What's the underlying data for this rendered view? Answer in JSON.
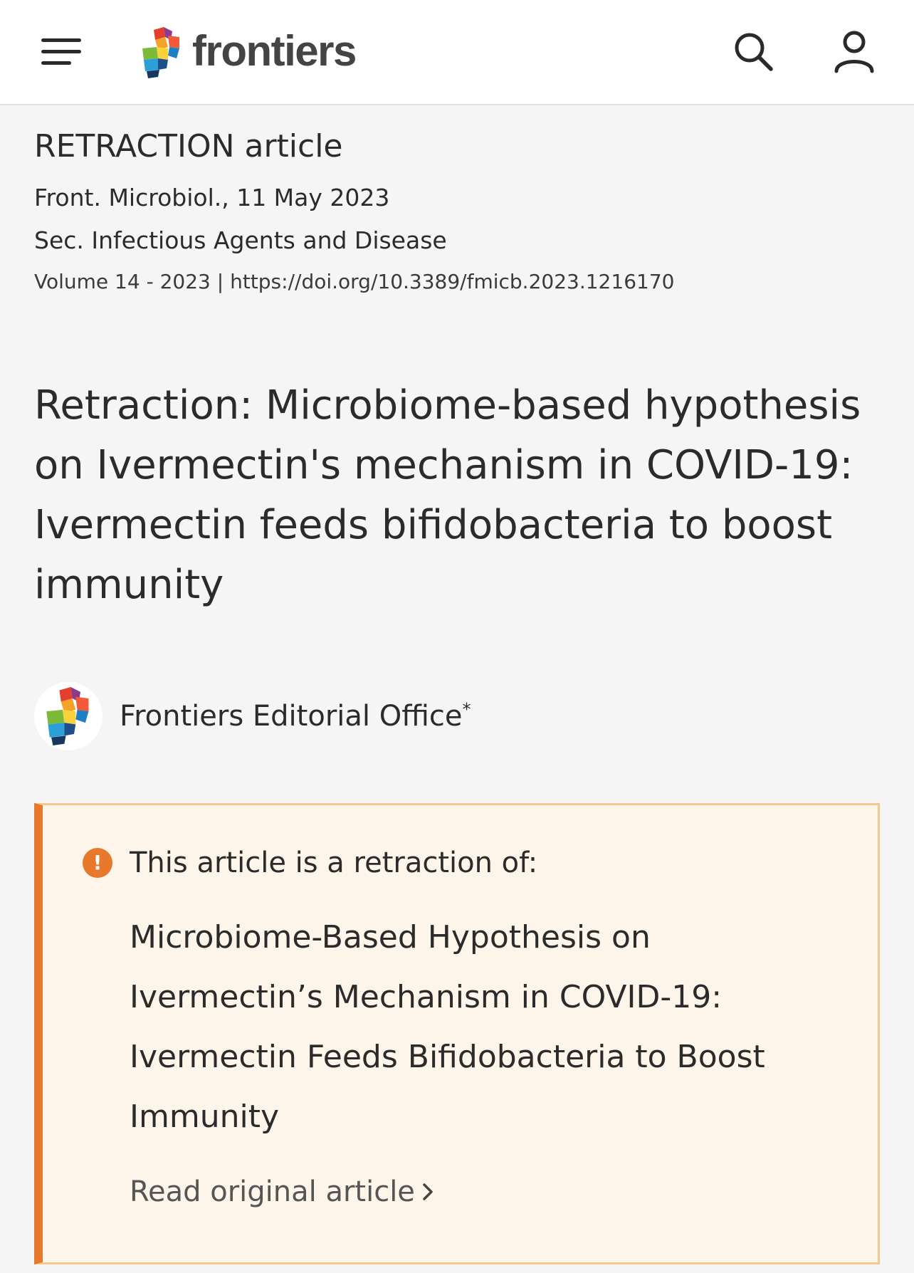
{
  "header": {
    "logo_text": "frontiers",
    "icons": {
      "menu": "hamburger-menu-icon",
      "search": "search-icon",
      "account": "user-icon"
    }
  },
  "article": {
    "type": "RETRACTION article",
    "journal_line": "Front. Microbiol., 11 May 2023",
    "section_line": "Sec. Infectious Agents and Disease",
    "volume": "Volume 14 - 2023",
    "separator": " | ",
    "doi": "https://doi.org/10.3389/fmicb.2023.1216170",
    "title": "Retraction: Microbiome-based hypothesis on Ivermectin's mechanism in COVID-19: Ivermectin feeds bifidobacteria to boost immunity"
  },
  "author": {
    "name": "Frontiers Editorial Office",
    "marker": "*"
  },
  "notice": {
    "icon_text": "!",
    "label": "This article is a retraction of:",
    "original_title": "Microbiome-Based Hypothesis on Ivermectin’s Mechanism in COVID-19: Ivermectin Feeds Bifidobacteria to Boost Immunity",
    "link_label": "Read original article"
  },
  "colors": {
    "accent_orange": "#e8782c",
    "notice_bg": "#fdf4ea",
    "notice_border": "#f2c98f",
    "page_bg": "#f5f5f5"
  }
}
